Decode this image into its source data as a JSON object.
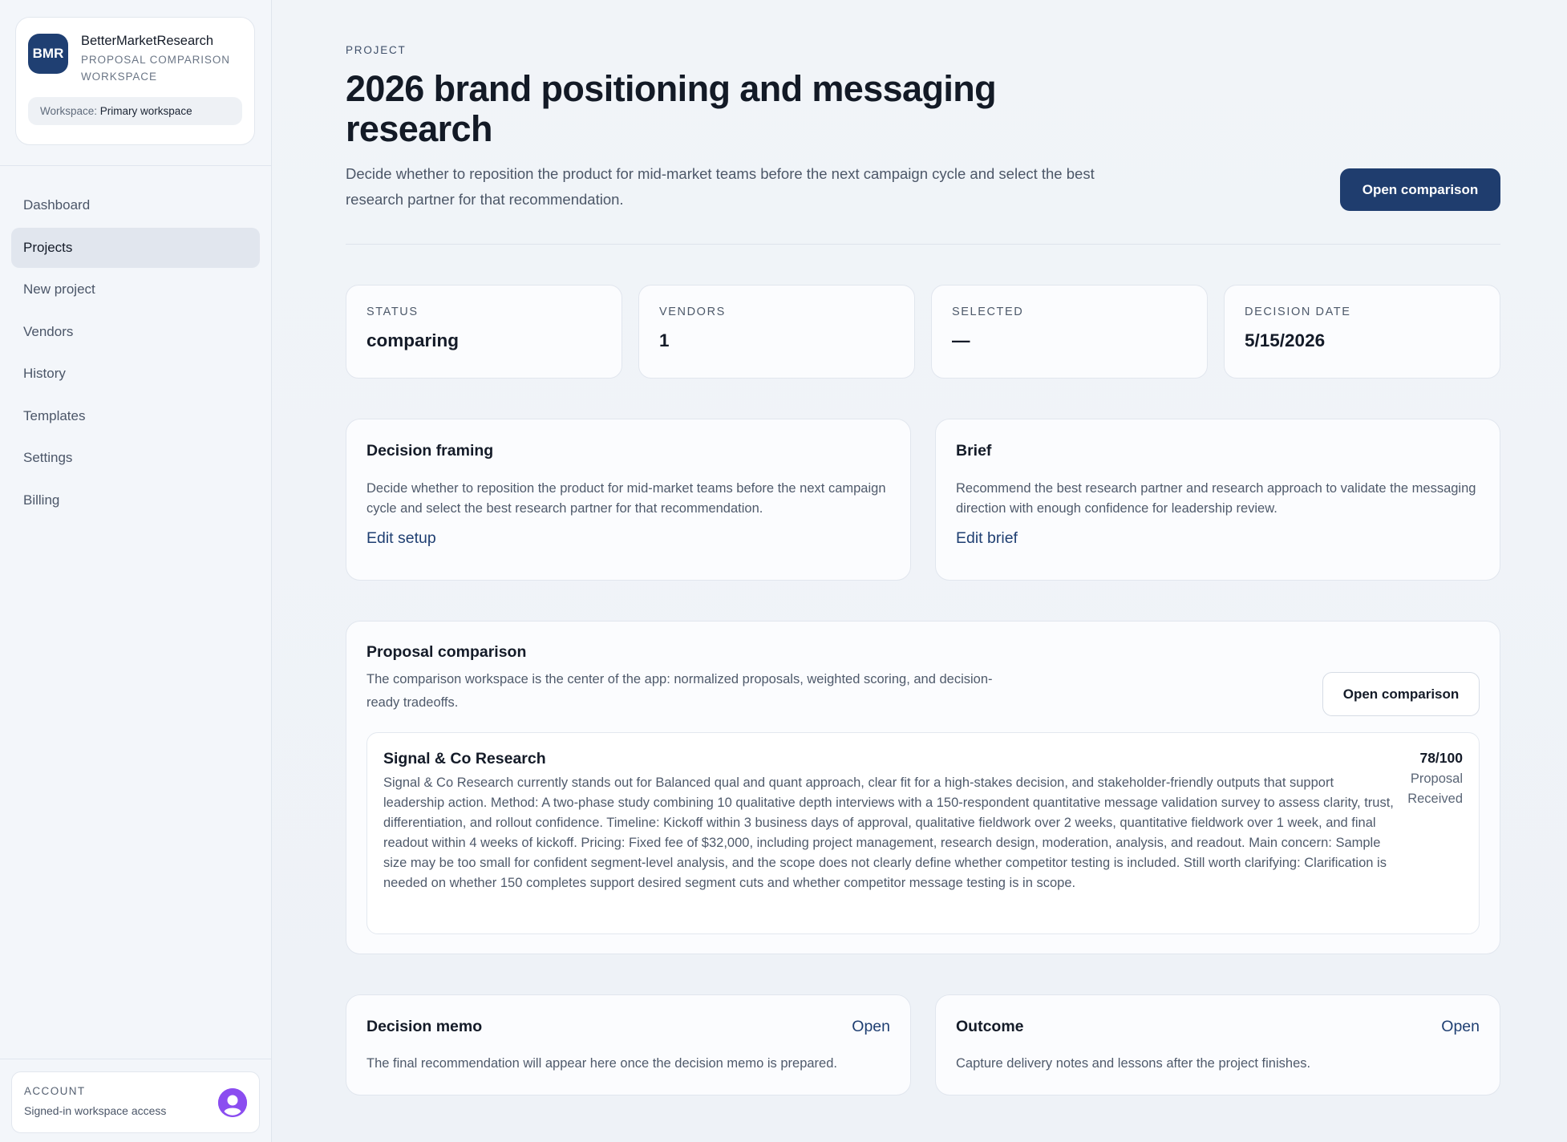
{
  "brand": {
    "logo_text": "BMR",
    "name": "BetterMarketResearch",
    "subtitle": "PROPOSAL COMPARISON WORKSPACE",
    "workspace_label": "Workspace:",
    "workspace_value": "Primary workspace"
  },
  "nav": {
    "items": [
      {
        "label": "Dashboard"
      },
      {
        "label": "Projects"
      },
      {
        "label": "New project"
      },
      {
        "label": "Vendors"
      },
      {
        "label": "History"
      },
      {
        "label": "Templates"
      },
      {
        "label": "Settings"
      },
      {
        "label": "Billing"
      }
    ],
    "active": "Projects"
  },
  "account": {
    "label": "ACCOUNT",
    "description": "Signed-in workspace access",
    "avatar_icon": "user-avatar-icon",
    "avatar_color": "#8b4df0"
  },
  "header": {
    "eyebrow": "PROJECT",
    "title": "2026 brand positioning and messaging research",
    "description": "Decide whether to reposition the product for mid-market teams before the next campaign cycle and select the best research partner for that recommendation.",
    "open_comparison_label": "Open comparison"
  },
  "stats": [
    {
      "label": "STATUS",
      "value": "comparing"
    },
    {
      "label": "VENDORS",
      "value": "1"
    },
    {
      "label": "SELECTED",
      "value": "—"
    },
    {
      "label": "DECISION DATE",
      "value": "5/15/2026"
    }
  ],
  "framing": {
    "title": "Decision framing",
    "text": "Decide whether to reposition the product for mid-market teams before the next campaign cycle and select the best research partner for that recommendation.",
    "link": "Edit setup"
  },
  "brief": {
    "title": "Brief",
    "text": "Recommend the best research partner and research approach to validate the messaging direction with enough confidence for leadership review.",
    "link": "Edit brief"
  },
  "comparison": {
    "title": "Proposal comparison",
    "text": "The comparison workspace is the center of the app: normalized proposals, weighted scoring, and decision-ready tradeoffs.",
    "button": "Open comparison",
    "vendor": {
      "name": "Signal & Co Research",
      "description": "Signal & Co Research currently stands out for Balanced qual and quant approach, clear fit for a high-stakes decision, and stakeholder-friendly outputs that support leadership action. Method: A two-phase study combining 10 qualitative depth interviews with a 150-respondent quantitative message validation survey to assess clarity, trust, differentiation, and rollout confidence. Timeline: Kickoff within 3 business days of approval, qualitative fieldwork over 2 weeks, quantitative fieldwork over 1 week, and final readout within 4 weeks of kickoff. Pricing: Fixed fee of $32,000, including project management, research design, moderation, analysis, and readout. Main concern: Sample size may be too small for confident segment-level analysis, and the scope does not clearly define whether competitor testing is included. Still worth clarifying: Clarification is needed on whether 150 completes support desired segment cuts and whether competitor message testing is in scope.",
      "score": "78/100",
      "status": "Proposal Received"
    }
  },
  "memo": {
    "title": "Decision memo",
    "link": "Open",
    "text": "The final recommendation will appear here once the decision memo is prepared."
  },
  "outcome": {
    "title": "Outcome",
    "link": "Open",
    "text": "Capture delivery notes and lessons after the project finishes."
  },
  "colors": {
    "accent": "#1f3d6e",
    "link": "#1f3f72"
  }
}
